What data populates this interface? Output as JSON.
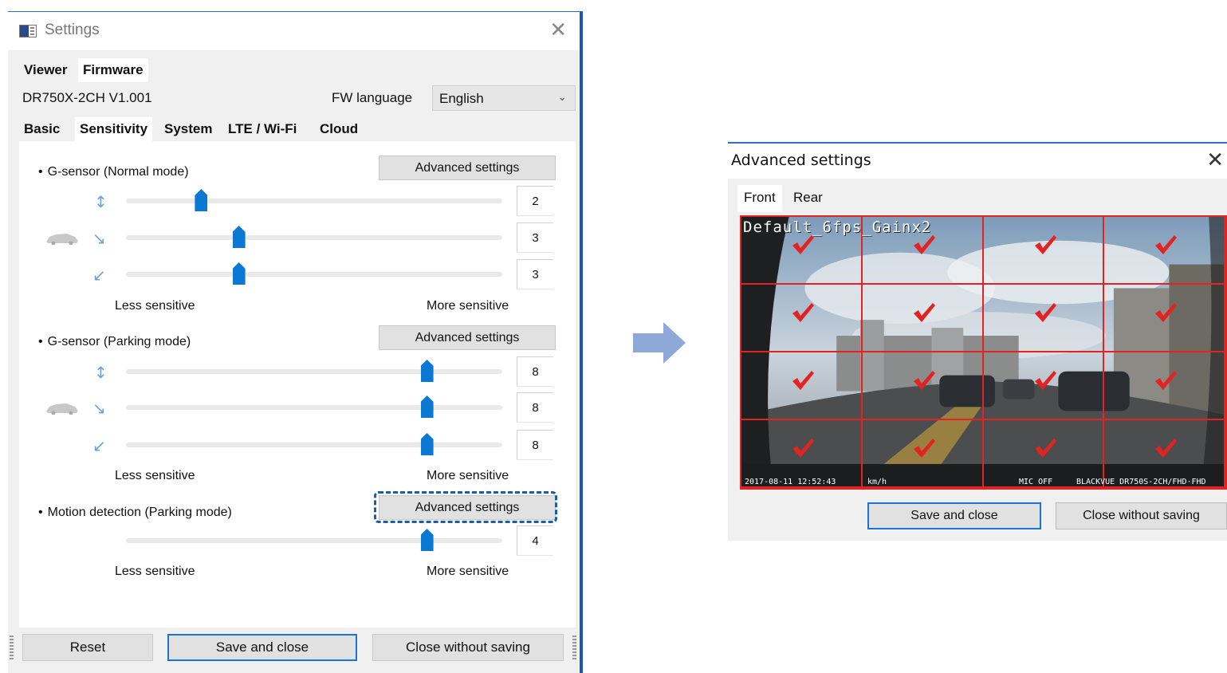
{
  "settings": {
    "title": "Settings",
    "top_tabs": [
      {
        "label": "Viewer"
      },
      {
        "label": "Firmware"
      }
    ],
    "model": "DR750X-2CH V1.001",
    "fw_language_label": "FW language",
    "fw_language_value": "English",
    "sub_tabs": [
      {
        "label": "Basic"
      },
      {
        "label": "Sensitivity"
      },
      {
        "label": "System"
      },
      {
        "label": "LTE / Wi-Fi"
      },
      {
        "label": "Cloud"
      }
    ],
    "sections": [
      {
        "label": "G-sensor (Normal mode)",
        "advanced_label": "Advanced settings",
        "sliders": [
          {
            "axis": "vertical",
            "value": "2",
            "level": 0.2
          },
          {
            "axis": "horizontal",
            "value": "3",
            "level": 0.3
          },
          {
            "axis": "diagonal",
            "value": "3",
            "level": 0.3
          }
        ],
        "less_label": "Less sensitive",
        "more_label": "More sensitive"
      },
      {
        "label": "G-sensor (Parking mode)",
        "advanced_label": "Advanced settings",
        "sliders": [
          {
            "axis": "vertical",
            "value": "8",
            "level": 0.8
          },
          {
            "axis": "horizontal",
            "value": "8",
            "level": 0.8
          },
          {
            "axis": "diagonal",
            "value": "8",
            "level": 0.8
          }
        ],
        "less_label": "Less sensitive",
        "more_label": "More sensitive"
      },
      {
        "label": "Motion detection (Parking mode)",
        "advanced_label": "Advanced settings",
        "sliders": [
          {
            "axis": "motion",
            "value": "4",
            "level": 0.8
          }
        ],
        "less_label": "Less sensitive",
        "more_label": "More sensitive"
      }
    ],
    "buttons": {
      "reset": "Reset",
      "save": "Save and close",
      "close": "Close without saving"
    },
    "accent": "#0b78d4"
  },
  "advanced": {
    "title": "Advanced settings",
    "tabs": [
      {
        "label": "Front"
      },
      {
        "label": "Rear"
      }
    ],
    "osd_top": "Default_6fps_Gainx2",
    "osd_date": "2017-08-11 12:52:43",
    "osd_speed": "km/h",
    "osd_mic": "MIC OFF",
    "osd_model": "BLACKVUE DR750S-2CH/FHD·FHD",
    "grid_checked": [
      1,
      1,
      1,
      1,
      1,
      1,
      1,
      1,
      1,
      1,
      1,
      1,
      1,
      1,
      1,
      1
    ],
    "buttons": {
      "save": "Save and close",
      "close": "Close without saving"
    },
    "grid_color": "#e32222"
  }
}
